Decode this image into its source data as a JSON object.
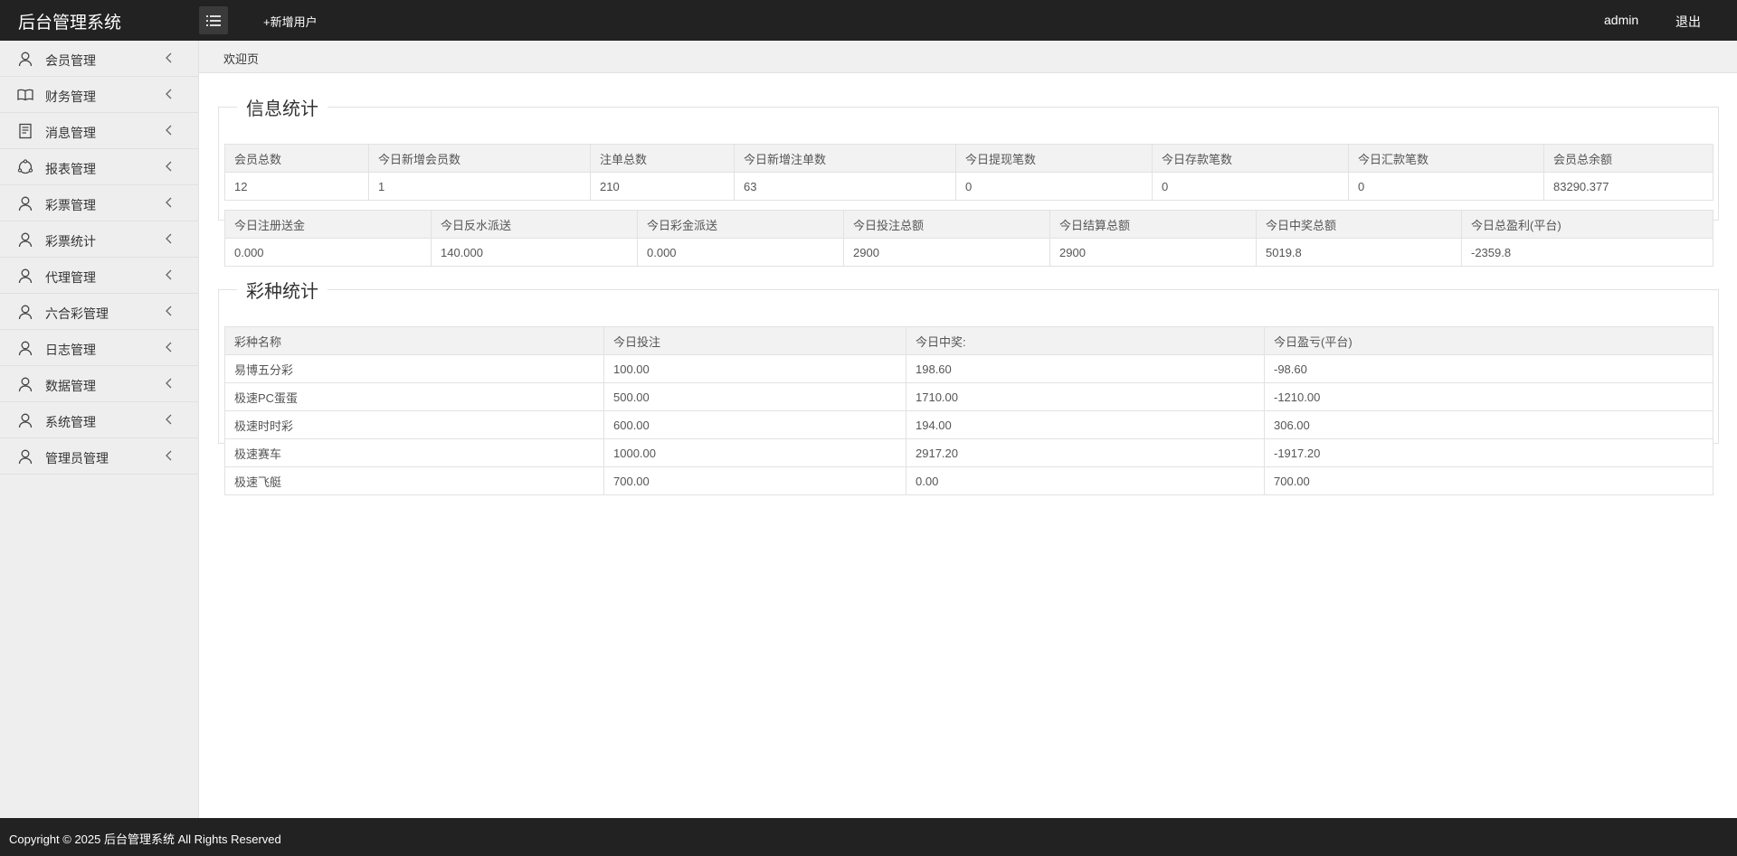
{
  "header": {
    "logo": "后台管理系统",
    "add_user": "+新增用户",
    "username": "admin",
    "logout": "退出"
  },
  "sidebar": {
    "items": [
      {
        "label": "会员管理",
        "icon": "user-icon"
      },
      {
        "label": "财务管理",
        "icon": "book-icon"
      },
      {
        "label": "消息管理",
        "icon": "document-icon"
      },
      {
        "label": "报表管理",
        "icon": "chart-icon"
      },
      {
        "label": "彩票管理",
        "icon": "user-icon"
      },
      {
        "label": "彩票统计",
        "icon": "user-icon"
      },
      {
        "label": "代理管理",
        "icon": "user-icon"
      },
      {
        "label": "六合彩管理",
        "icon": "user-icon"
      },
      {
        "label": "日志管理",
        "icon": "user-icon"
      },
      {
        "label": "数据管理",
        "icon": "user-icon"
      },
      {
        "label": "系统管理",
        "icon": "user-icon"
      },
      {
        "label": "管理员管理",
        "icon": "user-icon"
      }
    ]
  },
  "tabs": {
    "welcome": "欢迎页"
  },
  "info_stats": {
    "title": "信息统计",
    "table1": {
      "headers": [
        "会员总数",
        "今日新增会员数",
        "注单总数",
        "今日新增注单数",
        "今日提现笔数",
        "今日存款笔数",
        "今日汇款笔数",
        "会员总余额"
      ],
      "values": [
        "12",
        "1",
        "210",
        "63",
        "0",
        "0",
        "0",
        "83290.377"
      ]
    },
    "table2": {
      "headers": [
        "今日注册送金",
        "今日反水派送",
        "今日彩金派送",
        "今日投注总额",
        "今日结算总额",
        "今日中奖总额",
        "今日总盈利(平台)"
      ],
      "values": [
        "0.000",
        "140.000",
        "0.000",
        "2900",
        "2900",
        "5019.8",
        "-2359.8"
      ]
    }
  },
  "lottery_stats": {
    "title": "彩种统计",
    "headers": [
      "彩种名称",
      "今日投注",
      "今日中奖:",
      "今日盈亏(平台)"
    ],
    "rows": [
      [
        "易博五分彩",
        "100.00",
        "198.60",
        "-98.60"
      ],
      [
        "极速PC蛋蛋",
        "500.00",
        "1710.00",
        "-1210.00"
      ],
      [
        "极速时时彩",
        "600.00",
        "194.00",
        "306.00"
      ],
      [
        "极速赛车",
        "1000.00",
        "2917.20",
        "-1917.20"
      ],
      [
        "极速飞艇",
        "700.00",
        "0.00",
        "700.00"
      ]
    ]
  },
  "footer": {
    "copyright": "Copyright © 2025 后台管理系统 All Rights Reserved"
  }
}
